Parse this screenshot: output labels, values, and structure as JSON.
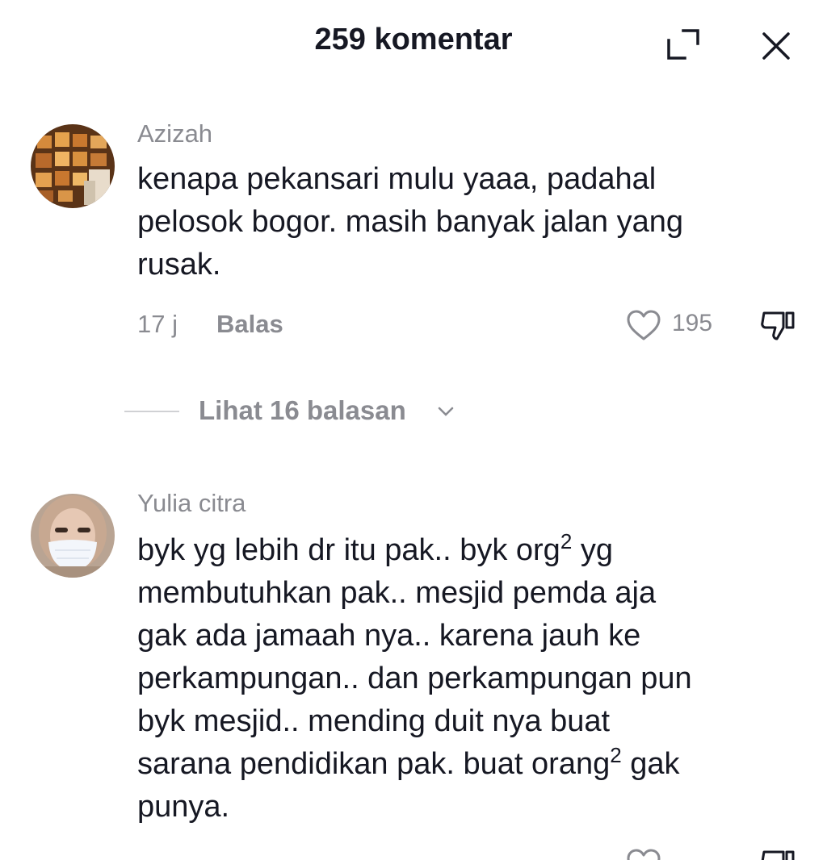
{
  "header": {
    "title": "259 komentar"
  },
  "comments": [
    {
      "username": "Azizah",
      "text_lines": [
        "kenapa pekansari mulu yaaa, padahal",
        "pelosok bogor. masih banyak jalan yang",
        "rusak."
      ],
      "time": "17 j",
      "reply_label": "Balas",
      "likes": "195",
      "view_replies": "Lihat 16 balasan"
    },
    {
      "username": "Yulia citra",
      "line1_pre": "byk yg lebih dr itu pak.. byk org",
      "line1_sup": "2",
      "line1_post": " yg",
      "line2": "membutuhkan pak.. mesjid pemda aja",
      "line3": "gak ada jamaah nya.. karena jauh ke",
      "line4": "perkampungan.. dan perkampungan pun",
      "line5": "byk mesjid.. mending duit nya buat",
      "line6_pre": "sarana pendidikan pak. buat orang",
      "line6_sup": "2",
      "line6_post": " gak",
      "line7": "punya."
    }
  ],
  "colors": {
    "primary_text": "#161823",
    "secondary_text": "#8a8b91",
    "background": "#ffffff"
  },
  "icons": {
    "expand": "expand-icon",
    "close": "close-icon",
    "like": "heart-icon",
    "dislike": "thumbs-down-icon",
    "chevron": "chevron-down-icon"
  }
}
